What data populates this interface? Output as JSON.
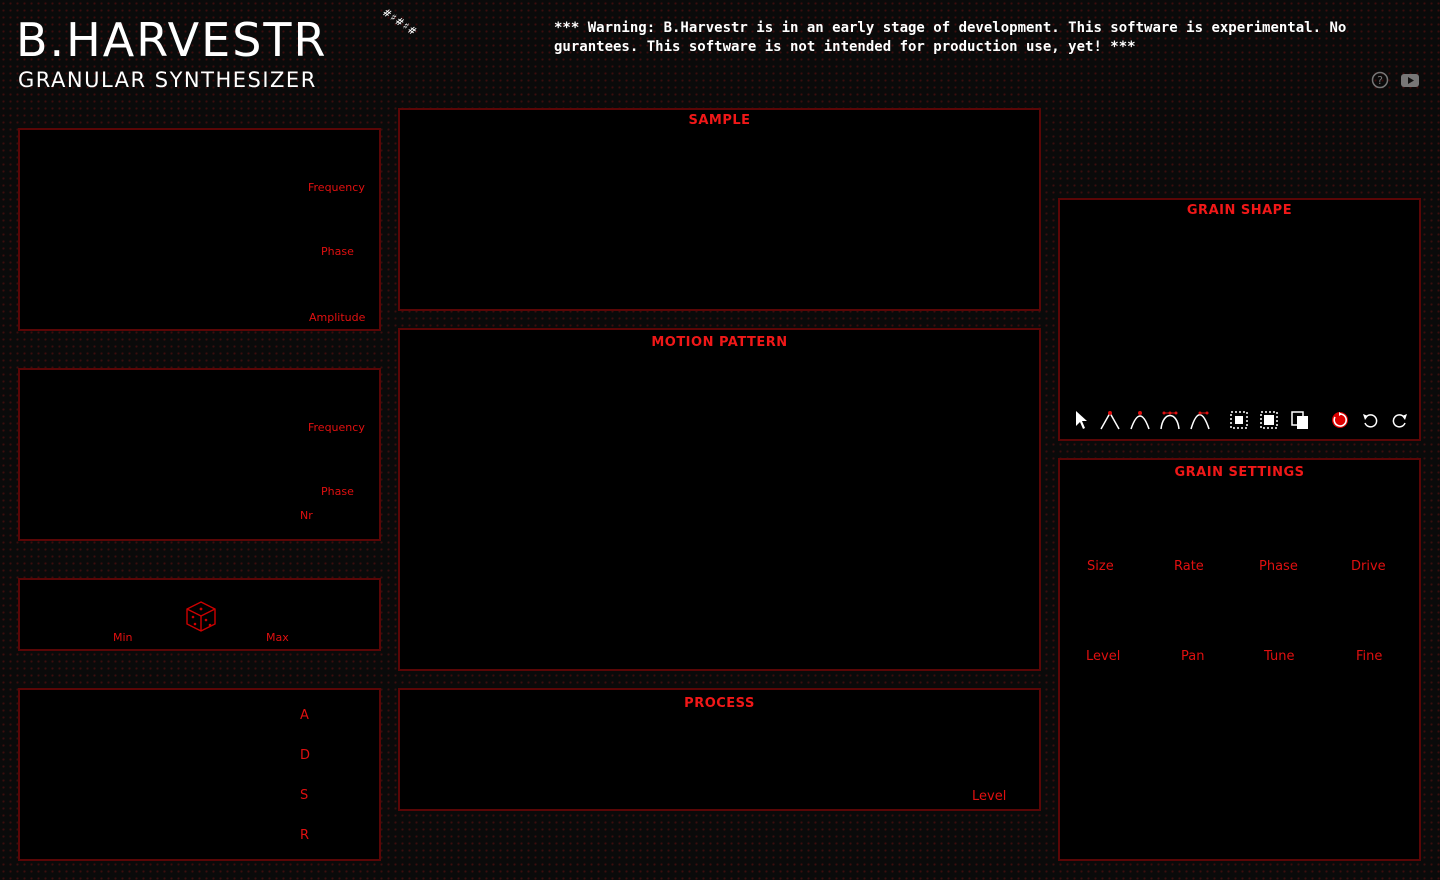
{
  "app": {
    "title": "B.HARVESTR",
    "subtitle": "GRANULAR SYNTHESIZER",
    "logo_glyphs": "#♯#♯#"
  },
  "warning": "*** Warning: B.Harvestr is in an early stage of development. This software is experimental. No gurantees. This software is not intended for production use, yet! ***",
  "header_icons": [
    "help-icon",
    "youtube-icon"
  ],
  "colors": {
    "accent": "#e01010",
    "panel_border": "#5a0606",
    "background": "#0a0a0a",
    "text": "#ffffff"
  },
  "lfo1": {
    "labels": {
      "frequency": "Frequency",
      "phase": "Phase",
      "amplitude": "Amplitude"
    }
  },
  "lfo2": {
    "labels": {
      "frequency": "Frequency",
      "phase": "Phase",
      "nr": "Nr"
    }
  },
  "random": {
    "labels": {
      "min": "Min",
      "max": "Max"
    },
    "icon": "dice-icon"
  },
  "envelope": {
    "labels": {
      "a": "A",
      "d": "D",
      "s": "S",
      "r": "R"
    }
  },
  "sample": {
    "title": "SAMPLE"
  },
  "motion": {
    "title": "MOTION PATTERN"
  },
  "process": {
    "title": "PROCESS",
    "level_label": "Level"
  },
  "grain_shape": {
    "title": "GRAIN SHAPE",
    "tools": [
      "select-pointer-icon",
      "node-sharp-icon",
      "node-smooth-icon",
      "node-bezier-icon",
      "node-asym-icon",
      "select-area-icon",
      "copy-icon",
      "paste-icon",
      "reset-icon",
      "undo-icon",
      "redo-icon"
    ]
  },
  "grain_settings": {
    "title": "GRAIN SETTINGS",
    "row1": [
      "Size",
      "Rate",
      "Phase",
      "Drive"
    ],
    "row2": [
      "Level",
      "Pan",
      "Tune",
      "Fine"
    ]
  }
}
